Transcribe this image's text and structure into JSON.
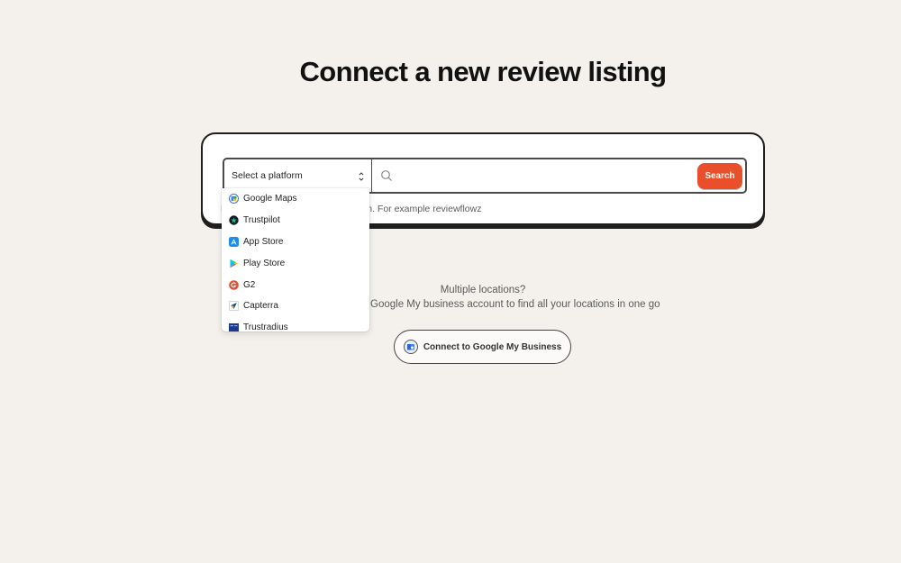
{
  "page_title": "Connect a new review listing",
  "search": {
    "platform_placeholder": "Select a platform",
    "input_value": "",
    "button_label": "Search",
    "hint": "Enter your business name to search. For example reviewflowz"
  },
  "platforms": [
    {
      "label": "Google Maps",
      "icon": "google-maps-icon"
    },
    {
      "label": "Trustpilot",
      "icon": "trustpilot-icon"
    },
    {
      "label": "App Store",
      "icon": "app-store-icon"
    },
    {
      "label": "Play Store",
      "icon": "play-store-icon"
    },
    {
      "label": "G2",
      "icon": "g2-icon"
    },
    {
      "label": "Capterra",
      "icon": "capterra-icon"
    },
    {
      "label": "Trustradius",
      "icon": "trustradius-icon"
    }
  ],
  "multi_location": {
    "question": "Multiple locations?",
    "description": "Connect your Google My business account to find all your locations in one go",
    "button_label": "Connect to Google My Business",
    "button_icon": "google-my-business-icon"
  },
  "colors": {
    "background": "#f4f1ed",
    "accent": "#e94f2b"
  }
}
